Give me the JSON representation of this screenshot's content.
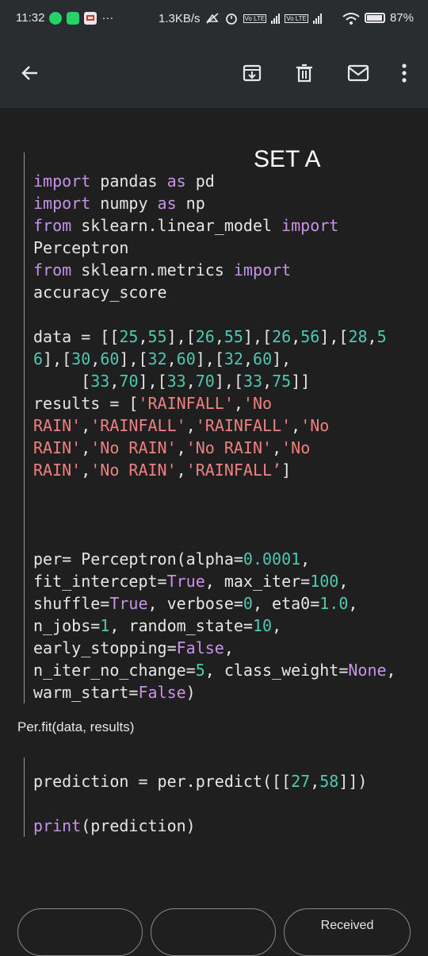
{
  "status_bar": {
    "time": "11:32",
    "overflow": "···",
    "net_speed": "1.3KB/s",
    "lte1": "Vo LTE",
    "lte2": "Vo LTE",
    "battery": "87%"
  },
  "toolbar": {
    "icons": [
      "back-arrow-icon",
      "archive-icon",
      "delete-icon",
      "mail-icon",
      "more-vert-icon"
    ]
  },
  "email": {
    "heading": "SET A",
    "code_block_1": [
      [
        [
          "kw",
          "import"
        ],
        [
          "t",
          " pandas "
        ],
        [
          "kw",
          "as"
        ],
        [
          "t",
          " pd"
        ]
      ],
      [
        [
          "kw",
          "import"
        ],
        [
          "t",
          " numpy "
        ],
        [
          "kw",
          "as"
        ],
        [
          "t",
          " np"
        ]
      ],
      [
        [
          "kw",
          "from"
        ],
        [
          "t",
          " sklearn.linear_model "
        ],
        [
          "kw",
          "import"
        ]
      ],
      [
        [
          "t",
          "Perceptron"
        ]
      ],
      [
        [
          "kw",
          "from"
        ],
        [
          "t",
          " sklearn.metrics "
        ],
        [
          "kw",
          "import"
        ]
      ],
      [
        [
          "t",
          "accuracy_score"
        ]
      ],
      [
        [
          "t",
          ""
        ]
      ],
      [
        [
          "t",
          "data = [["
        ],
        [
          "num",
          "25"
        ],
        [
          "t",
          ","
        ],
        [
          "num",
          "55"
        ],
        [
          "t",
          "],["
        ],
        [
          "num",
          "26"
        ],
        [
          "t",
          ","
        ],
        [
          "num",
          "55"
        ],
        [
          "t",
          "],["
        ],
        [
          "num",
          "26"
        ],
        [
          "t",
          ","
        ],
        [
          "num",
          "56"
        ],
        [
          "t",
          "],["
        ],
        [
          "num",
          "28"
        ],
        [
          "t",
          ","
        ],
        [
          "num",
          "5"
        ]
      ],
      [
        [
          "num",
          "6"
        ],
        [
          "t",
          "],["
        ],
        [
          "num",
          "30"
        ],
        [
          "t",
          ","
        ],
        [
          "num",
          "60"
        ],
        [
          "t",
          "],["
        ],
        [
          "num",
          "32"
        ],
        [
          "t",
          ","
        ],
        [
          "num",
          "60"
        ],
        [
          "t",
          "],["
        ],
        [
          "num",
          "32"
        ],
        [
          "t",
          ","
        ],
        [
          "num",
          "60"
        ],
        [
          "t",
          "],"
        ]
      ],
      [
        [
          "t",
          "     ["
        ],
        [
          "num",
          "33"
        ],
        [
          "t",
          ","
        ],
        [
          "num",
          "70"
        ],
        [
          "t",
          "],["
        ],
        [
          "num",
          "33"
        ],
        [
          "t",
          ","
        ],
        [
          "num",
          "70"
        ],
        [
          "t",
          "],["
        ],
        [
          "num",
          "33"
        ],
        [
          "t",
          ","
        ],
        [
          "num",
          "75"
        ],
        [
          "t",
          "]]"
        ]
      ],
      [
        [
          "t",
          "results = ["
        ],
        [
          "str",
          "'RAINFALL'"
        ],
        [
          "t",
          ","
        ],
        [
          "str",
          "'No"
        ]
      ],
      [
        [
          "str",
          "RAIN'"
        ],
        [
          "t",
          ","
        ],
        [
          "str",
          "'RAINFALL'"
        ],
        [
          "t",
          ","
        ],
        [
          "str",
          "'RAINFALL'"
        ],
        [
          "t",
          ","
        ],
        [
          "str",
          "'No"
        ]
      ],
      [
        [
          "str",
          "RAIN'"
        ],
        [
          "t",
          ","
        ],
        [
          "str",
          "'No RAIN'"
        ],
        [
          "t",
          ","
        ],
        [
          "str",
          "'No RAIN'"
        ],
        [
          "t",
          ","
        ],
        [
          "str",
          "'No"
        ]
      ],
      [
        [
          "str",
          "RAIN'"
        ],
        [
          "t",
          ","
        ],
        [
          "str",
          "'No RAIN'"
        ],
        [
          "t",
          ","
        ],
        [
          "str",
          "'RAINFALL’"
        ],
        [
          "t",
          "]"
        ]
      ],
      [
        [
          "t",
          ""
        ]
      ],
      [
        [
          "t",
          ""
        ]
      ],
      [
        [
          "t",
          ""
        ]
      ],
      [
        [
          "t",
          "per= Perceptron(alpha="
        ],
        [
          "num",
          "0.0001"
        ],
        [
          "t",
          ","
        ]
      ],
      [
        [
          "t",
          "fit_intercept="
        ],
        [
          "kw",
          "True"
        ],
        [
          "t",
          ", max_iter="
        ],
        [
          "num",
          "100"
        ],
        [
          "t",
          ","
        ]
      ],
      [
        [
          "t",
          "shuffle="
        ],
        [
          "kw",
          "True"
        ],
        [
          "t",
          ", verbose="
        ],
        [
          "num",
          "0"
        ],
        [
          "t",
          ", eta0="
        ],
        [
          "num",
          "1.0"
        ],
        [
          "t",
          ","
        ]
      ],
      [
        [
          "t",
          "n_jobs="
        ],
        [
          "num",
          "1"
        ],
        [
          "t",
          ", random_state="
        ],
        [
          "num",
          "10"
        ],
        [
          "t",
          ","
        ]
      ],
      [
        [
          "t",
          "early_stopping="
        ],
        [
          "kw",
          "False"
        ],
        [
          "t",
          ","
        ]
      ],
      [
        [
          "t",
          "n_iter_no_change="
        ],
        [
          "num",
          "5"
        ],
        [
          "t",
          ", class_weight="
        ],
        [
          "kw",
          "None"
        ],
        [
          "t",
          ","
        ]
      ],
      [
        [
          "t",
          "warm_start="
        ],
        [
          "kw",
          "False"
        ],
        [
          "t",
          ")"
        ]
      ]
    ],
    "fit_line": "Per.fit(data, results)",
    "code_block_2": [
      [
        [
          "t",
          "prediction = per.predict([["
        ],
        [
          "num",
          "27"
        ],
        [
          "t",
          ","
        ],
        [
          "num",
          "58"
        ],
        [
          "t",
          "]])"
        ]
      ],
      [
        [
          "t",
          ""
        ]
      ],
      [
        [
          "kw",
          "print"
        ],
        [
          "t",
          "(prediction)"
        ]
      ]
    ]
  },
  "bottom_actions": [
    "",
    "",
    "Received"
  ],
  "colors": {
    "keyword": "#c792ea",
    "number": "#4ec9b0",
    "string": "#ef8080",
    "background": "#1f1f1f",
    "bar": "#2a2d30"
  }
}
